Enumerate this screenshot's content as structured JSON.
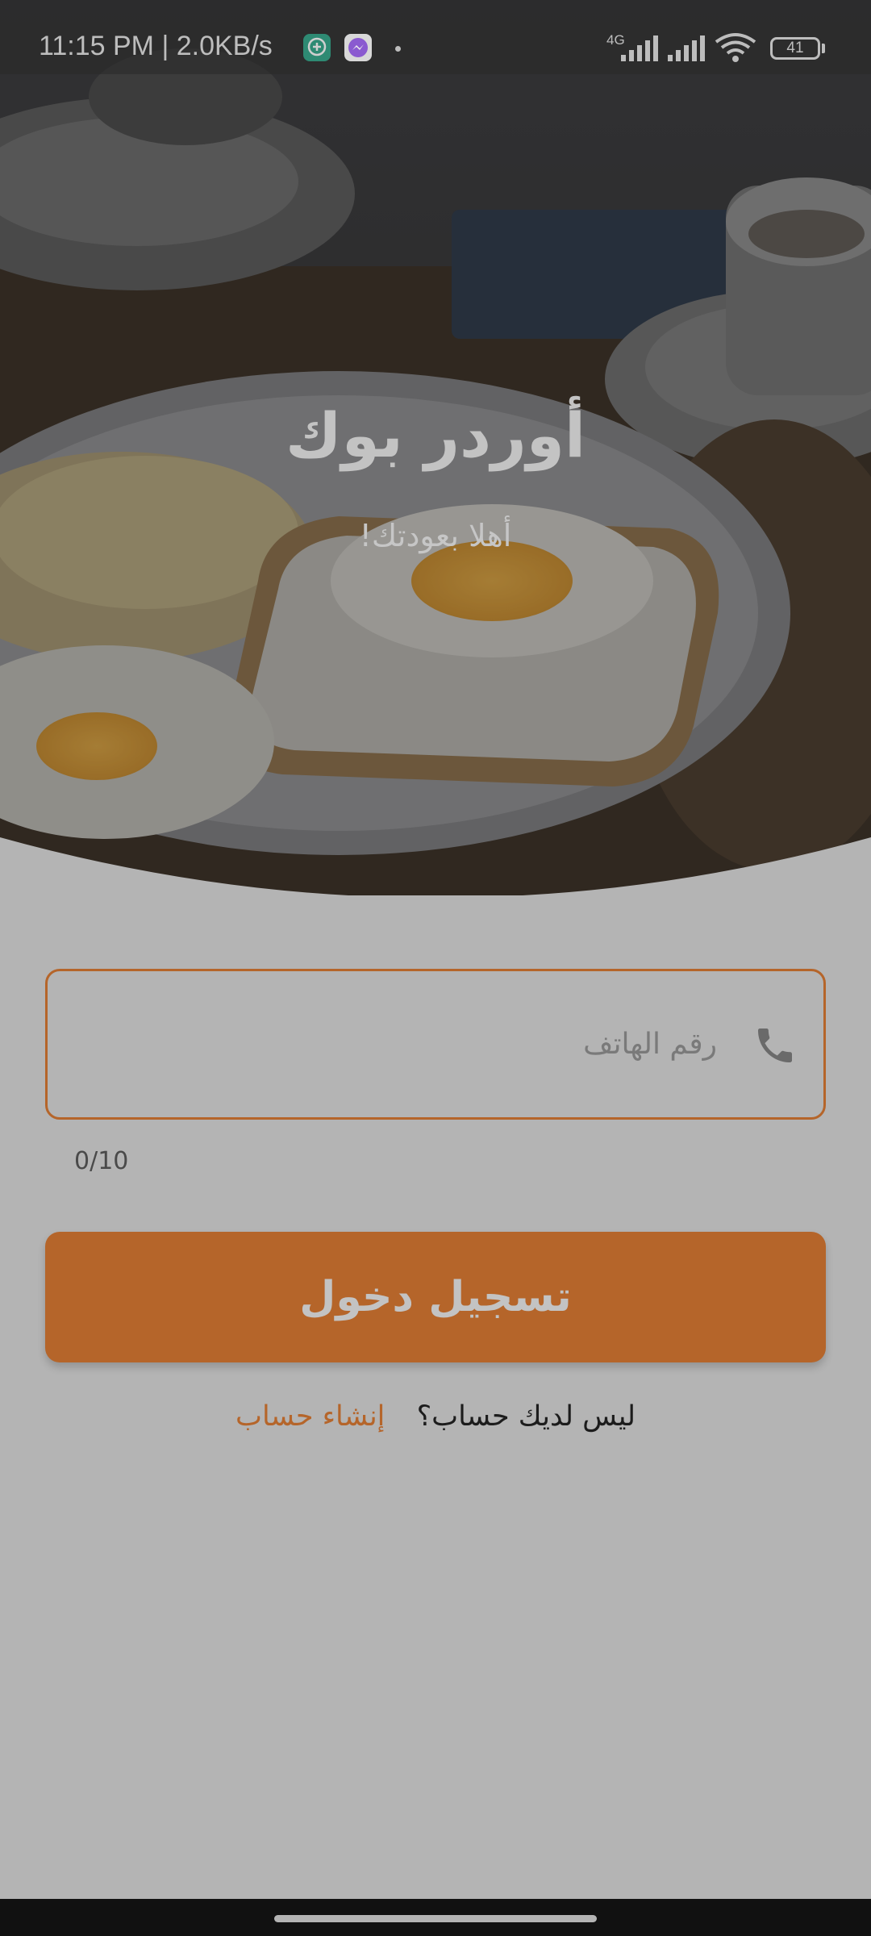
{
  "status_bar": {
    "time_speed": "11:15 PM | 2.0KB/s",
    "network_type": "4G",
    "battery_level": "41",
    "icons": [
      "chat-app-icon",
      "messenger-icon",
      "signal-icon",
      "wifi-icon",
      "battery-icon"
    ]
  },
  "hero": {
    "title": "أوردر بوك",
    "subtitle": "أهلا بعودتك!",
    "image": "breakfast-plate-photo"
  },
  "form": {
    "phone_placeholder": "رقم الهاتف",
    "phone_value": "",
    "phone_icon": "phone-icon",
    "char_counter": "0/10",
    "login_label": "تسجيل دخول"
  },
  "signup": {
    "question": "ليس لديك حساب؟",
    "link_label": "إنشاء حساب"
  },
  "colors": {
    "accent": "#b5652a",
    "background": "#b4b4b4"
  }
}
